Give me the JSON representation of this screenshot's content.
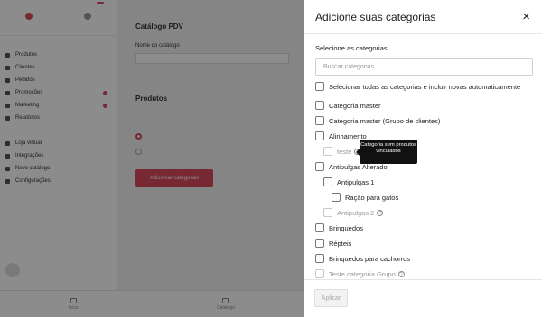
{
  "drawer": {
    "title": "Adicione suas categorias",
    "close_icon": "×",
    "section_label": "Selecione as categorias",
    "search_placeholder": "Buscar categorias",
    "select_all": "Selecionar todas as categorias e incluir novas automaticamente",
    "items": [
      {
        "label": "Categoria master",
        "level": 0,
        "disabled": false
      },
      {
        "label": "Categoria master (Grupo de clientes)",
        "level": 0,
        "disabled": false
      },
      {
        "label": "Alinhamento",
        "level": 0,
        "disabled": false
      },
      {
        "label": "teste",
        "level": 1,
        "disabled": true,
        "info": true
      },
      {
        "label": "Antipulgas Alterado",
        "level": 0,
        "disabled": false
      },
      {
        "label": "Antipulgas 1",
        "level": 1,
        "disabled": false
      },
      {
        "label": "Ração para gatos",
        "level": 2,
        "disabled": false
      },
      {
        "label": "Antipulgas 2",
        "level": 1,
        "disabled": true,
        "info": true
      },
      {
        "label": "Brinquedos",
        "level": 0,
        "disabled": false
      },
      {
        "label": "Répteis",
        "level": 0,
        "disabled": false
      },
      {
        "label": "Brinquedos para cachorros",
        "level": 0,
        "disabled": false
      },
      {
        "label": "Teste categoria Grupo",
        "level": 0,
        "disabled": true,
        "info": true
      }
    ],
    "tooltip": "Categoria sem produtos vinculados",
    "apply_label": "Aplicar"
  },
  "background": {
    "top_items": [
      {
        "label": "",
        "tag": ""
      },
      {
        "label": "",
        "tag": ""
      }
    ],
    "main_heading": "Catálogo PDV",
    "main_desc": "",
    "field_label": "Nome do catálogo",
    "section_heading": "Produtos",
    "radio_label": "",
    "radio_options": [
      "",
      ""
    ],
    "button_label": "Adicionar categorias",
    "sidebar_items": [
      {
        "label": "Produtos",
        "badge": false
      },
      {
        "label": "Clientes",
        "badge": false
      },
      {
        "label": "Pedidos",
        "badge": false
      },
      {
        "label": "Promoções",
        "badge": true
      },
      {
        "label": "Marketing",
        "badge": true
      },
      {
        "label": "Relatórios",
        "badge": false
      }
    ],
    "sidebar_items_2": [
      {
        "label": "Loja virtual",
        "badge": false
      },
      {
        "label": "Integrações",
        "badge": false
      },
      {
        "label": "Novo catálogo",
        "badge": false
      },
      {
        "label": "Configurações",
        "badge": false
      }
    ],
    "user_name": "",
    "user_sub": "",
    "bottom_items": [
      "Início",
      "Catálogo"
    ]
  }
}
